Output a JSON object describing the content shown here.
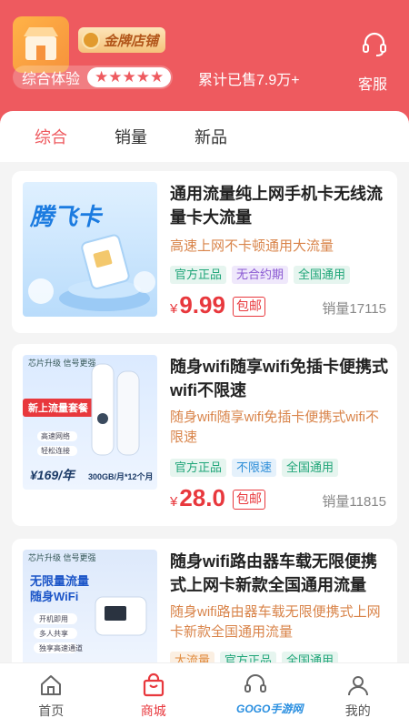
{
  "header": {
    "shop_badge": "金牌店铺",
    "rating_label": "综合体验",
    "stars": "★★★★★",
    "sold": "累计已售7.9万+",
    "service_label": "客服"
  },
  "tabs": [
    {
      "label": "综合",
      "active": true
    },
    {
      "label": "销量",
      "active": false
    },
    {
      "label": "新品",
      "active": false
    }
  ],
  "products": [
    {
      "thumb_title": "腾飞卡",
      "title": "通用流量纯上网手机卡无线流量卡大流量",
      "subtitle": "高速上网不卡顿通用大流量",
      "tags": [
        {
          "text": "官方正品",
          "color": "green"
        },
        {
          "text": "无合约期",
          "color": "purple"
        },
        {
          "text": "全国通用",
          "color": "green"
        }
      ],
      "yen": "¥",
      "price": "9.99",
      "shipping": "包邮",
      "sales": "销量17115"
    },
    {
      "thumb_banner": "新上流量套餐",
      "thumb_header": "芯片升级  信号更强",
      "thumb_price": "¥169/年",
      "thumb_plan": "300GB/月*12个月",
      "thumb_features": [
        "高速网络",
        "轻松连接"
      ],
      "title": "随身wifi随享wifi免插卡便携式wifi不限速",
      "subtitle": "随身wifi随享wifi免插卡便携式wifi不限速",
      "tags": [
        {
          "text": "官方正品",
          "color": "green"
        },
        {
          "text": "不限速",
          "color": "blue"
        },
        {
          "text": "全国通用",
          "color": "green"
        }
      ],
      "yen": "¥",
      "price": "28.0",
      "shipping": "包邮",
      "sales": "销量11815"
    },
    {
      "thumb_header": "芯片升级  信号更强",
      "thumb_headline": "无限量流量\n随身WiFi",
      "thumb_features": [
        "开机即用",
        "多人共享",
        "独享高速通道"
      ],
      "title": "随身wifi路由器车载无限便携式上网卡新款全国通用流量",
      "subtitle": "随身wifi路由器车载无限便携式上网卡新款全国通用流量",
      "tags": [
        {
          "text": "大流量",
          "color": "orange"
        },
        {
          "text": "官方正品",
          "color": "green"
        },
        {
          "text": "全国通用",
          "color": "green"
        }
      ]
    }
  ],
  "bottom_nav": [
    {
      "label": "首页",
      "icon": "home-icon",
      "active": false
    },
    {
      "label": "商城",
      "icon": "shopping-bag-icon",
      "active": true
    },
    {
      "label": "",
      "icon": "headset-icon",
      "active": false
    },
    {
      "label": "我的",
      "icon": "user-icon",
      "active": false
    }
  ],
  "watermark": "GOGO手游网",
  "colors": {
    "brand_red": "#ee5a5f",
    "price_red": "#e8383d"
  }
}
